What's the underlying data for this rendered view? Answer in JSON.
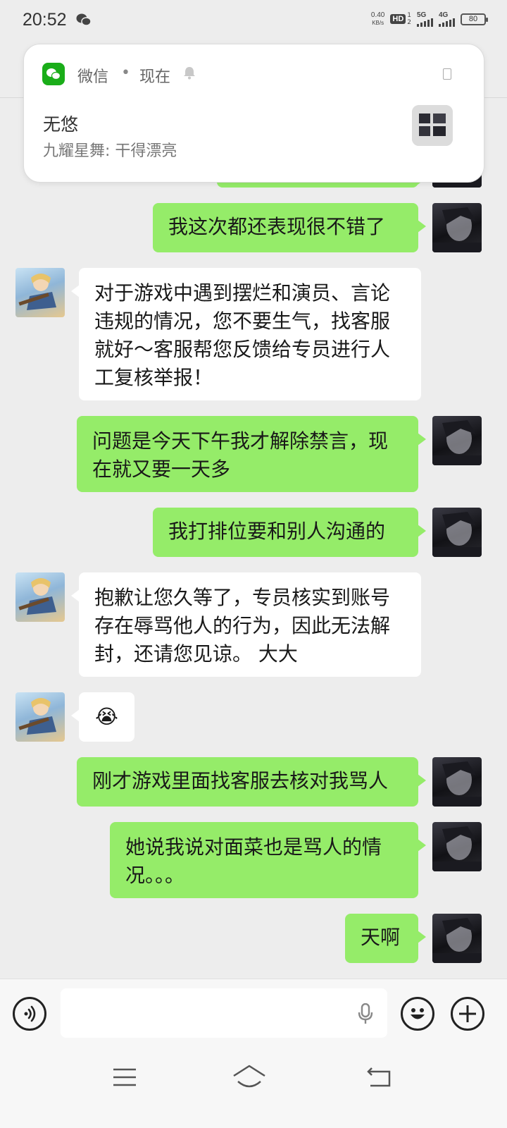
{
  "status_bar": {
    "time": "20:52",
    "net_speed_value": "0.40",
    "net_speed_unit": "KB/s",
    "hd_label": "HD",
    "hd_sim1": "1",
    "hd_sim2": "2",
    "sim1_network": "5G",
    "sim2_network": "4G",
    "battery": "80"
  },
  "notification": {
    "app_name": "微信",
    "separator": "•",
    "time": "现在",
    "title": "无悠",
    "body": "九耀星舞: 干得漂亮"
  },
  "messages": [
    {
      "from": "self",
      "text": "我这次都还表现很不错了"
    },
    {
      "from": "other",
      "text": "对于游戏中遇到摆烂和演员、言论\n违规的情况，您不要生气，找客服\n就好～客服帮您反馈给专员进行人\n工复核举报！"
    },
    {
      "from": "self",
      "text": "问题是今天下午我才解除禁言，现\n在就又要一天多"
    },
    {
      "from": "self",
      "text": "我打排位要和别人沟通的"
    },
    {
      "from": "other",
      "text": "抱歉让您久等了，专员核实到账号\n存在辱骂他人的行为，因此无法解\n封，还请您见谅。 大大"
    },
    {
      "from": "other",
      "text": "😭"
    },
    {
      "from": "self",
      "text": "刚才游戏里面找客服去核对我骂人"
    },
    {
      "from": "self",
      "text": "她说我说对面菜也是骂人的情\n况。。。"
    },
    {
      "from": "self",
      "text": "天啊"
    }
  ],
  "colors": {
    "self_bubble": "#95ec69",
    "other_bubble": "#ffffff",
    "background": "#ededed",
    "wechat_green": "#1aad19"
  }
}
